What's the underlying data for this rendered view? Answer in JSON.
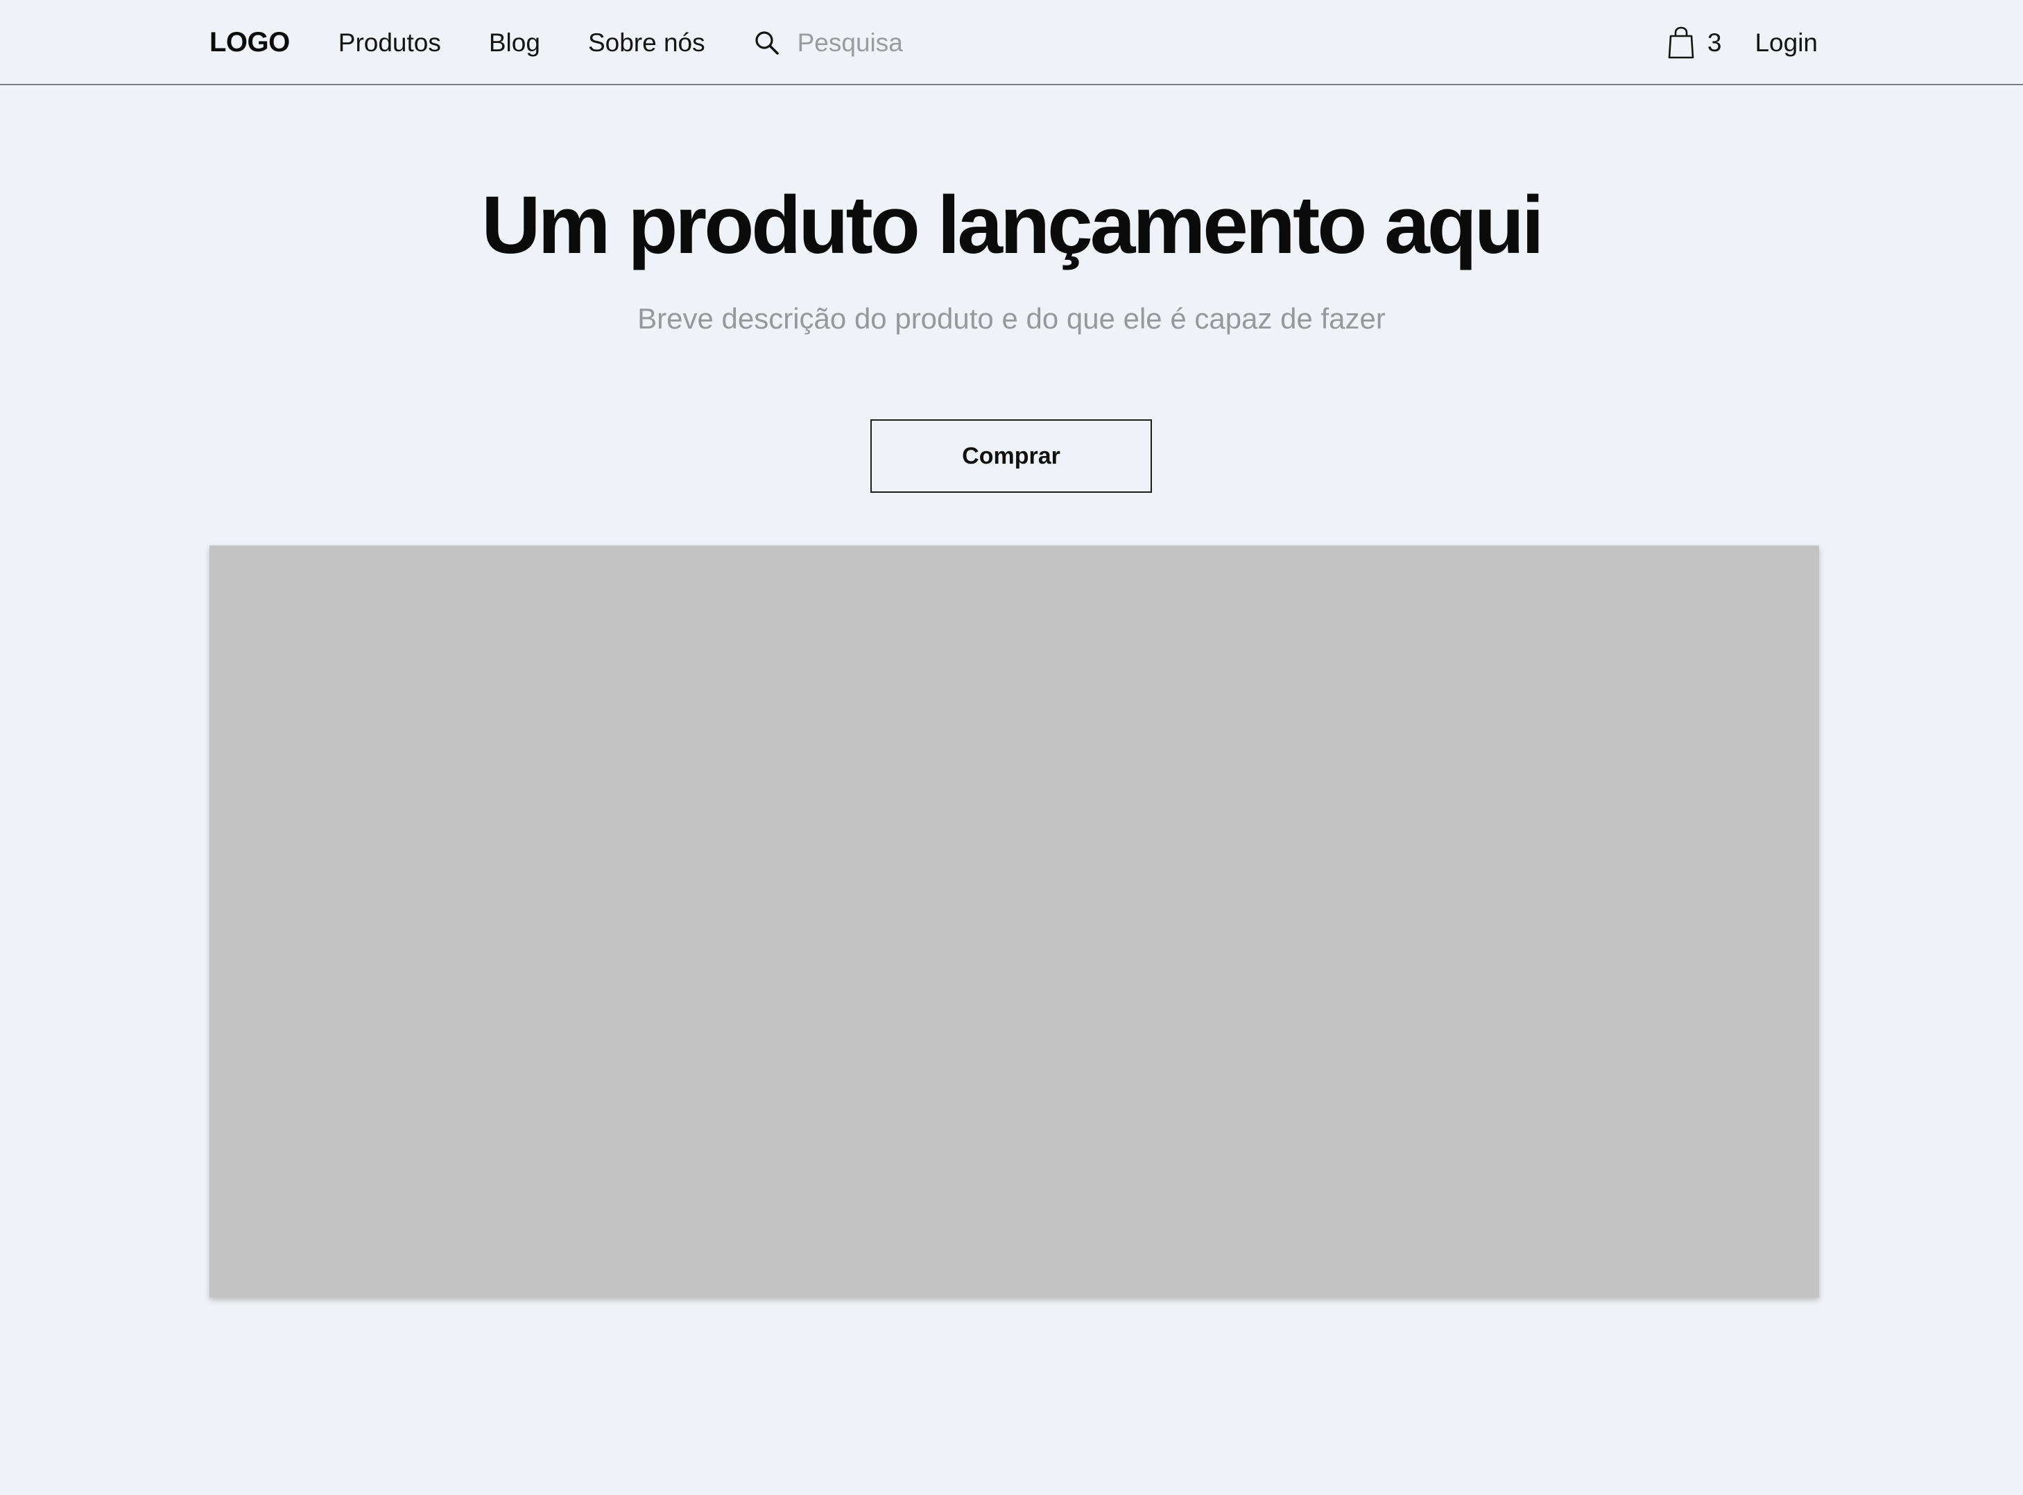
{
  "header": {
    "logo": "LOGO",
    "nav": [
      {
        "label": "Produtos"
      },
      {
        "label": "Blog"
      },
      {
        "label": "Sobre nós"
      }
    ],
    "search": {
      "placeholder": "Pesquisa",
      "icon": "search-icon"
    },
    "cart": {
      "icon": "shopping-bag-icon",
      "count": "3"
    },
    "login_label": "Login"
  },
  "hero": {
    "title": "Um produto lançamento aqui",
    "description": "Breve descrição do produto e do que ele é capaz de fazer",
    "buy_label": "Comprar"
  },
  "colors": {
    "background": "#eff2f6",
    "image_placeholder": "#c3c3c3",
    "text_primary": "#111111",
    "text_muted": "#96989c"
  }
}
